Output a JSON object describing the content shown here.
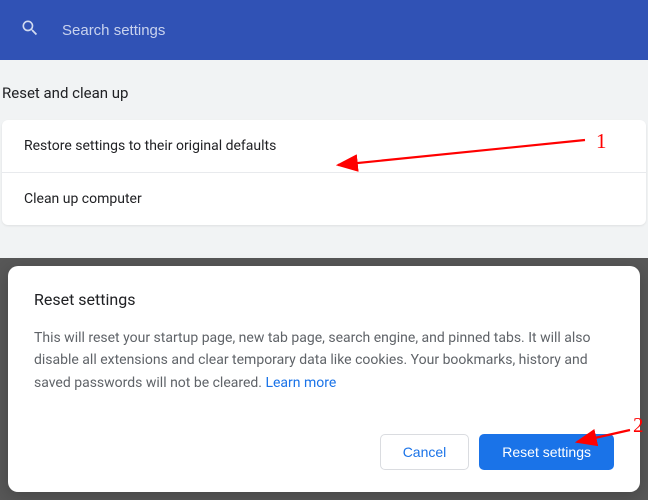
{
  "search": {
    "placeholder": "Search settings"
  },
  "section": {
    "title": "Reset and clean up",
    "rows": {
      "restore": "Restore settings to their original defaults",
      "cleanup": "Clean up computer"
    }
  },
  "modal": {
    "title": "Reset settings",
    "body": "This will reset your startup page, new tab page, search engine, and pinned tabs. It will also disable all extensions and clear temporary data like cookies. Your bookmarks, history and saved passwords will not be cleared. ",
    "learn_more": "Learn more",
    "cancel": "Cancel",
    "confirm": "Reset settings"
  },
  "annotations": {
    "one": "1",
    "two": "2"
  }
}
